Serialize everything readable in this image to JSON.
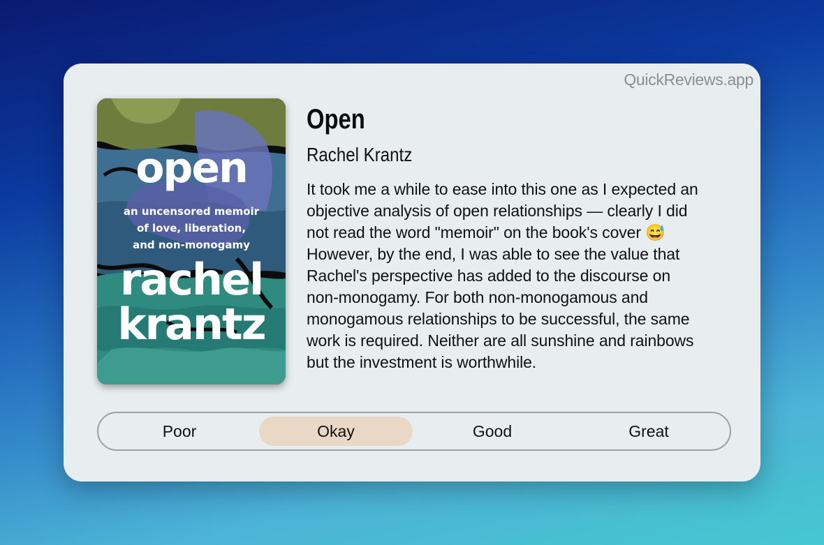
{
  "brand": "QuickReviews.app",
  "book": {
    "cover": {
      "title": "open",
      "subtitle": "an uncensored memoir\nof love, liberation,\nand non-monogamy",
      "author": "rachel\nkrantz"
    },
    "title": "Open",
    "author": "Rachel Krantz",
    "review": "It took me a while to ease into this one as I expected an objective analysis of open relationships — clearly I did not read the word \"memoir\" on the book's cover 😅 However, by the end, I was able to see the value that Rachel's perspective has added to the discourse on non-monogamy. For both non-monogamous and monogamous relationships to be successful, the same work is required. Neither are all sunshine and rainbows but the investment is worthwhile."
  },
  "rating": {
    "options": [
      "Poor",
      "Okay",
      "Good",
      "Great"
    ],
    "selected": "Okay"
  },
  "colors": {
    "selected_option": "#ead8c6",
    "card_background": "#e8edf0"
  }
}
